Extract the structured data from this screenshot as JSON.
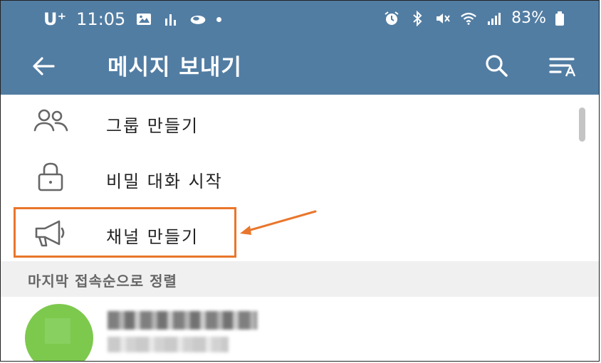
{
  "status_bar": {
    "carrier": "U⁺",
    "time": "11:05",
    "battery_percent": "83%"
  },
  "toolbar": {
    "title": "메시지 보내기"
  },
  "menu": {
    "items": [
      {
        "label": "그룹 만들기",
        "icon": "group-icon"
      },
      {
        "label": "비밀 대화 시작",
        "icon": "lock-icon"
      },
      {
        "label": "채널 만들기",
        "icon": "megaphone-icon"
      }
    ]
  },
  "section": {
    "label": "마지막 접속순으로 정렬"
  },
  "colors": {
    "appbar": "#527da3",
    "highlight": "#e9762b",
    "avatar": "#7dc94e"
  }
}
